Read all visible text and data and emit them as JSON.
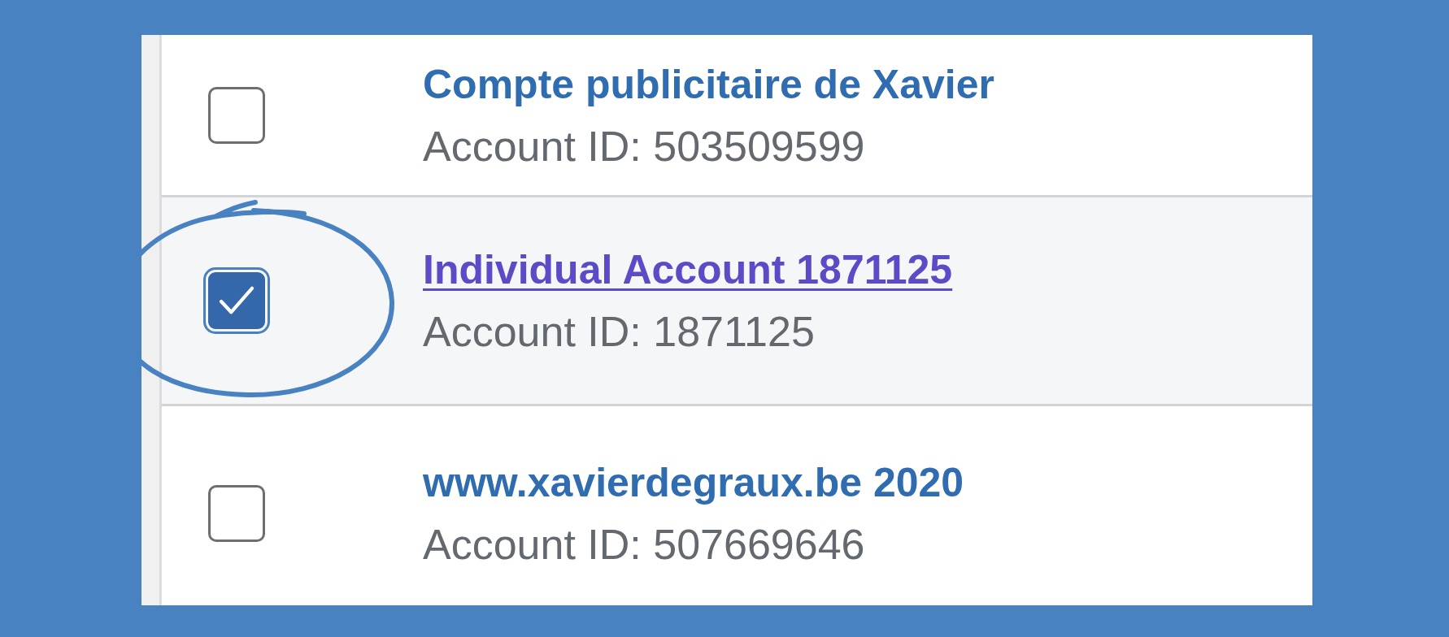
{
  "rows": [
    {
      "title": "Compte publicitaire de Xavier",
      "subtitle": "Account ID: 503509599",
      "checked": false,
      "highlighted": false,
      "circled": false
    },
    {
      "title": "Individual Account 1871125",
      "subtitle": "Account ID: 1871125",
      "checked": true,
      "highlighted": true,
      "circled": true
    },
    {
      "title": "www.xavierdegraux.be 2020",
      "subtitle": "Account ID: 507669646",
      "checked": false,
      "highlighted": false,
      "circled": false
    }
  ]
}
